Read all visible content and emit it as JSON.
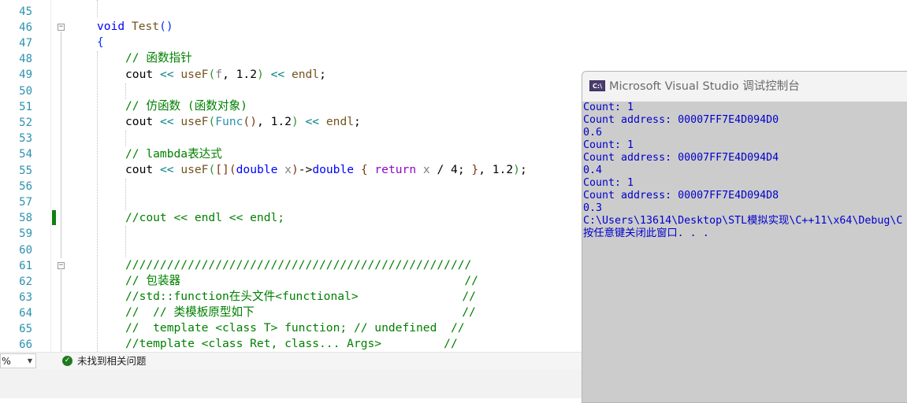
{
  "editor": {
    "line_numbers": [
      "45",
      "46",
      "47",
      "48",
      "49",
      "50",
      "51",
      "52",
      "53",
      "54",
      "55",
      "56",
      "57",
      "58",
      "59",
      "60",
      "61",
      "62",
      "63",
      "64",
      "65",
      "66"
    ],
    "code": {
      "l46_kw": "void",
      "l46_fn": "Test",
      "l46_parens": "()",
      "l47": "{",
      "l48": "// 函数指针",
      "l49_a": "cout ",
      "l49_op": "<<",
      "l49_fn": "useF",
      "l49_args_open": "(",
      "l49_f": "f",
      "l49_num": ", 1.2",
      "l49_close": ")",
      "l49_tail": " << ",
      "l49_endl": "endl",
      "l49_end": ";",
      "l51": "// 仿函数 (函数对象)",
      "l52_a": "cout ",
      "l52_op": "<<",
      "l52_fn": "useF",
      "l52_open": "(",
      "l52_type": "Func",
      "l52_ctor": "()",
      "l52_num": ", 1.2",
      "l52_close": ")",
      "l52_tail": " << ",
      "l52_endl": "endl",
      "l52_end": ";",
      "l54": "// lambda表达式",
      "l55_a": "cout ",
      "l55_op": "<<",
      "l55_fn": "useF",
      "l55_open": "(",
      "l55_lb": "[]",
      "l55_popen": "(",
      "l55_kw1": "double",
      "l55_param": " x",
      "l55_pclose": ")",
      "l55_arrow": "->",
      "l55_kw2": "double",
      "l55_bopen": " { ",
      "l55_ret": "return",
      "l55_x": " x",
      "l55_div": " / 4; ",
      "l55_bclose": "}",
      "l55_num": ", 1.2",
      "l55_close": ")",
      "l55_end": ";",
      "l58": "//cout << endl << endl;",
      "l61": "//////////////////////////////////////////////////",
      "l62": "// 包装器                                         //",
      "l63": "//std::function在头文件<functional>               //",
      "l64": "//  // 类模板原型如下                              //",
      "l65": "//  template <class T> function; // undefined  //",
      "l66": "//template <class Ret, class... Args>         //"
    }
  },
  "status_bar": {
    "zoom_value": "%",
    "issues_text": "未找到相关问题"
  },
  "console": {
    "title": "Microsoft Visual Studio 调试控制台",
    "icon_label": "C:\\",
    "lines": [
      "Count: 1",
      "Count address: 00007FF7E4D094D0",
      "0.6",
      "Count: 1",
      "Count address: 00007FF7E4D094D4",
      "0.4",
      "Count: 1",
      "Count address: 00007FF7E4D094D8",
      "0.3",
      "C:\\Users\\13614\\Desktop\\STL模拟实现\\C++11\\x64\\Debug\\C",
      "按任意键关闭此窗口. . ."
    ]
  },
  "colors": {
    "line_number": "#2b91af",
    "keyword": "#0000ff",
    "comment": "#008000",
    "function": "#74531f",
    "console_bg": "#cccccc",
    "console_text": "#0000cc",
    "change_bar": "#108010"
  }
}
